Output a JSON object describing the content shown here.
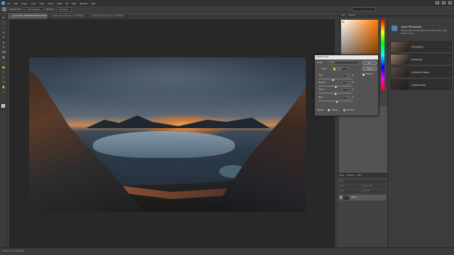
{
  "menubar": {
    "items": [
      "File",
      "Edit",
      "Image",
      "Layer",
      "Type",
      "Select",
      "Filter",
      "3D",
      "View",
      "Window",
      "Help"
    ]
  },
  "options": {
    "label1": "Sample Size:",
    "value1": "Point Sample",
    "label2": "Sample:",
    "value2": "All Layers"
  },
  "tabs": [
    {
      "label": "Lynd in SL19_2HKTEN0-6KKTR @ 26.9% (Layer 0, RGB/8)"
    },
    {
      "label": "Untitled-1 @ 33.3% (Layer 1, RGB/8#)"
    },
    {
      "label": "Untitled-2 @ 66.7% (Layer 1, RGB/8#)"
    }
  ],
  "toolbar": {
    "tools": [
      "▸",
      "⬚",
      "◌",
      "⌖",
      "✂",
      "⌀",
      "✎",
      "⌫",
      "▨",
      "◐",
      "✍",
      "T",
      "▷",
      "▭",
      "✋",
      "⌕",
      "…"
    ]
  },
  "status": {
    "text": "26.91%   Doc: 43.9M/49.3M"
  },
  "color_panel": {
    "tab1": "Color",
    "tab2": "Swatches",
    "fg_color": "#e6b07a"
  },
  "dialog": {
    "title": "Selective Color",
    "preset_label": "Preset:",
    "preset_value": "Custom",
    "colors_label": "Colors:",
    "colors_value": "Yellows",
    "ok": "OK",
    "cancel": "Cancel",
    "preview": "Preview",
    "sliders": [
      {
        "name": "Cyan:",
        "value": "-15",
        "level": -15
      },
      {
        "name": "Magenta:",
        "value": "+2",
        "level": 2
      },
      {
        "name": "Yellow:",
        "value": "0",
        "level": 0
      },
      {
        "name": "Black:",
        "value": "+8",
        "level": 8
      }
    ],
    "pct": "%",
    "method_label": "Method:",
    "relative": "Relative",
    "absolute": "Absolute"
  },
  "learn": {
    "title": "Learn Photoshop",
    "description": "Step-by-step tutorials directly in the app. Pick a topic below to begin.",
    "cards": [
      {
        "label": "Photography",
        "thumb": "#7a5e4a"
      },
      {
        "label": "Retouching",
        "thumb": "#9c7a66"
      },
      {
        "label": "Combining Images",
        "thumb": "#5a4a3e"
      },
      {
        "label": "Graphic Design",
        "thumb": "#3a3030"
      }
    ],
    "chevron": "›"
  },
  "layers_panel": {
    "tabs": [
      "Layers",
      "Channels",
      "Paths"
    ],
    "kind": "Kind",
    "blend": "Normal",
    "opacity": "Opacity: 100%",
    "lock": "Lock:",
    "fill": "Fill: 100%",
    "layer_name": "Layer 0"
  }
}
